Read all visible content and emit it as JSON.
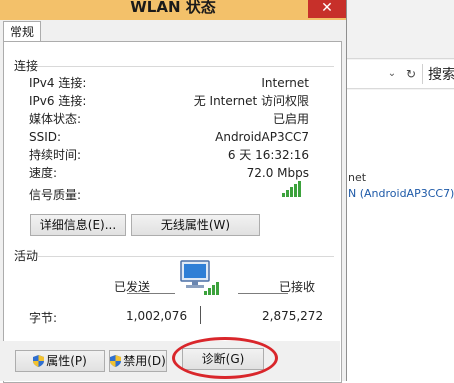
{
  "window": {
    "title": "WLAN 状态",
    "close_glyph": "✕"
  },
  "tabs": [
    {
      "label": "常规"
    }
  ],
  "connection": {
    "section_label": "连接",
    "rows": [
      {
        "label": "IPv4 连接:",
        "value": "Internet"
      },
      {
        "label": "IPv6 连接:",
        "value": "无 Internet 访问权限"
      },
      {
        "label": "媒体状态:",
        "value": "已启用"
      },
      {
        "label": "SSID:",
        "value": "AndroidAP3CC7"
      },
      {
        "label": "持续时间:",
        "value": "6 天 16:32:16"
      },
      {
        "label": "速度:",
        "value": "72.0 Mbps"
      }
    ],
    "signal_label": "信号质量:",
    "signal_icon": "signal-bars-icon",
    "details_button": "详细信息(E)...",
    "wireless_props_button": "无线属性(W)"
  },
  "activity": {
    "section_label": "活动",
    "sent_label": "已发送",
    "received_label": "已接收",
    "bytes_label": "字节:",
    "bytes_sent": "1,002,076",
    "bytes_received": "2,875,272",
    "icon": "network-computer-icon"
  },
  "buttons": {
    "properties": "属性(P)",
    "disable": "禁用(D)",
    "diagnose": "诊断(G)"
  },
  "background_window": {
    "search_label": "搜索",
    "network_line1": "net",
    "network_line2": "N (AndroidAP3CC7)"
  },
  "colors": {
    "titlebar": "#f3c16a",
    "close": "#c7302a",
    "highlight_circle": "#d9262b",
    "signal_green": "#3ca23c"
  }
}
